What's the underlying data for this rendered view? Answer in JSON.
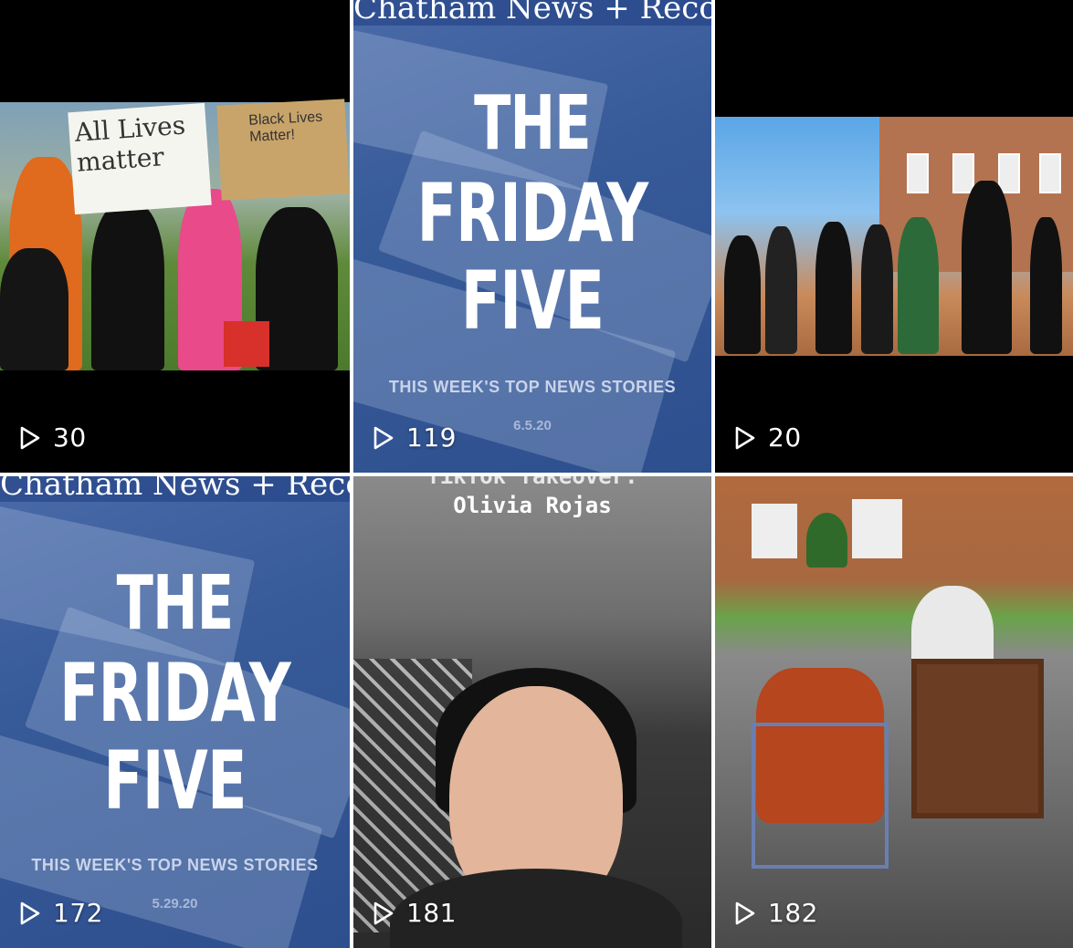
{
  "tiles": [
    {
      "views": "30",
      "sign1": "All Lives matter",
      "sign2": "Black Lives Matter!"
    },
    {
      "views": "119",
      "masthead": "Chatham News + Record",
      "title_line1": "THE",
      "title_line2": "FRIDAY",
      "title_line3": "FIVE",
      "subtitle": "THIS WEEK'S TOP NEWS STORIES",
      "date": "6.5.20"
    },
    {
      "views": "20"
    },
    {
      "views": "172",
      "masthead": "Chatham News + Record",
      "title_line1": "THE",
      "title_line2": "FRIDAY",
      "title_line3": "FIVE",
      "subtitle": "THIS WEEK'S TOP NEWS STORIES",
      "date": "5.29.20"
    },
    {
      "views": "181",
      "title_partial": "TikTok Takeover:",
      "name": "Olivia Rojas"
    },
    {
      "views": "182"
    }
  ],
  "icons": {
    "play": "play-outline-icon"
  }
}
